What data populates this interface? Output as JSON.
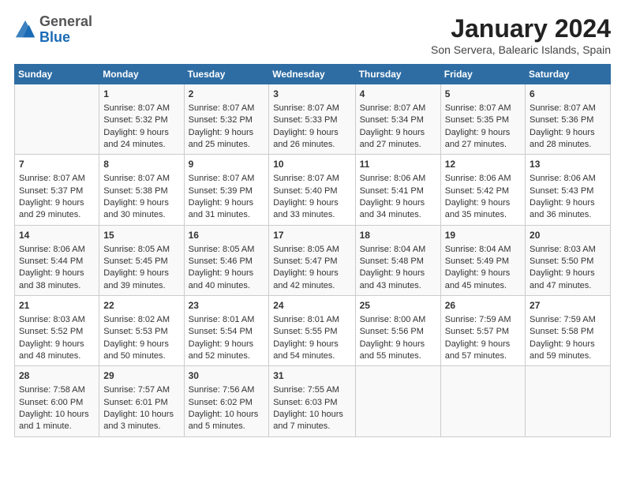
{
  "header": {
    "logo_general": "General",
    "logo_blue": "Blue",
    "month": "January 2024",
    "location": "Son Servera, Balearic Islands, Spain"
  },
  "days_of_week": [
    "Sunday",
    "Monday",
    "Tuesday",
    "Wednesday",
    "Thursday",
    "Friday",
    "Saturday"
  ],
  "weeks": [
    [
      {
        "day": "",
        "content": ""
      },
      {
        "day": "1",
        "content": "Sunrise: 8:07 AM\nSunset: 5:32 PM\nDaylight: 9 hours\nand 24 minutes."
      },
      {
        "day": "2",
        "content": "Sunrise: 8:07 AM\nSunset: 5:32 PM\nDaylight: 9 hours\nand 25 minutes."
      },
      {
        "day": "3",
        "content": "Sunrise: 8:07 AM\nSunset: 5:33 PM\nDaylight: 9 hours\nand 26 minutes."
      },
      {
        "day": "4",
        "content": "Sunrise: 8:07 AM\nSunset: 5:34 PM\nDaylight: 9 hours\nand 27 minutes."
      },
      {
        "day": "5",
        "content": "Sunrise: 8:07 AM\nSunset: 5:35 PM\nDaylight: 9 hours\nand 27 minutes."
      },
      {
        "day": "6",
        "content": "Sunrise: 8:07 AM\nSunset: 5:36 PM\nDaylight: 9 hours\nand 28 minutes."
      }
    ],
    [
      {
        "day": "7",
        "content": "Sunrise: 8:07 AM\nSunset: 5:37 PM\nDaylight: 9 hours\nand 29 minutes."
      },
      {
        "day": "8",
        "content": "Sunrise: 8:07 AM\nSunset: 5:38 PM\nDaylight: 9 hours\nand 30 minutes."
      },
      {
        "day": "9",
        "content": "Sunrise: 8:07 AM\nSunset: 5:39 PM\nDaylight: 9 hours\nand 31 minutes."
      },
      {
        "day": "10",
        "content": "Sunrise: 8:07 AM\nSunset: 5:40 PM\nDaylight: 9 hours\nand 33 minutes."
      },
      {
        "day": "11",
        "content": "Sunrise: 8:06 AM\nSunset: 5:41 PM\nDaylight: 9 hours\nand 34 minutes."
      },
      {
        "day": "12",
        "content": "Sunrise: 8:06 AM\nSunset: 5:42 PM\nDaylight: 9 hours\nand 35 minutes."
      },
      {
        "day": "13",
        "content": "Sunrise: 8:06 AM\nSunset: 5:43 PM\nDaylight: 9 hours\nand 36 minutes."
      }
    ],
    [
      {
        "day": "14",
        "content": "Sunrise: 8:06 AM\nSunset: 5:44 PM\nDaylight: 9 hours\nand 38 minutes."
      },
      {
        "day": "15",
        "content": "Sunrise: 8:05 AM\nSunset: 5:45 PM\nDaylight: 9 hours\nand 39 minutes."
      },
      {
        "day": "16",
        "content": "Sunrise: 8:05 AM\nSunset: 5:46 PM\nDaylight: 9 hours\nand 40 minutes."
      },
      {
        "day": "17",
        "content": "Sunrise: 8:05 AM\nSunset: 5:47 PM\nDaylight: 9 hours\nand 42 minutes."
      },
      {
        "day": "18",
        "content": "Sunrise: 8:04 AM\nSunset: 5:48 PM\nDaylight: 9 hours\nand 43 minutes."
      },
      {
        "day": "19",
        "content": "Sunrise: 8:04 AM\nSunset: 5:49 PM\nDaylight: 9 hours\nand 45 minutes."
      },
      {
        "day": "20",
        "content": "Sunrise: 8:03 AM\nSunset: 5:50 PM\nDaylight: 9 hours\nand 47 minutes."
      }
    ],
    [
      {
        "day": "21",
        "content": "Sunrise: 8:03 AM\nSunset: 5:52 PM\nDaylight: 9 hours\nand 48 minutes."
      },
      {
        "day": "22",
        "content": "Sunrise: 8:02 AM\nSunset: 5:53 PM\nDaylight: 9 hours\nand 50 minutes."
      },
      {
        "day": "23",
        "content": "Sunrise: 8:01 AM\nSunset: 5:54 PM\nDaylight: 9 hours\nand 52 minutes."
      },
      {
        "day": "24",
        "content": "Sunrise: 8:01 AM\nSunset: 5:55 PM\nDaylight: 9 hours\nand 54 minutes."
      },
      {
        "day": "25",
        "content": "Sunrise: 8:00 AM\nSunset: 5:56 PM\nDaylight: 9 hours\nand 55 minutes."
      },
      {
        "day": "26",
        "content": "Sunrise: 7:59 AM\nSunset: 5:57 PM\nDaylight: 9 hours\nand 57 minutes."
      },
      {
        "day": "27",
        "content": "Sunrise: 7:59 AM\nSunset: 5:58 PM\nDaylight: 9 hours\nand 59 minutes."
      }
    ],
    [
      {
        "day": "28",
        "content": "Sunrise: 7:58 AM\nSunset: 6:00 PM\nDaylight: 10 hours\nand 1 minute."
      },
      {
        "day": "29",
        "content": "Sunrise: 7:57 AM\nSunset: 6:01 PM\nDaylight: 10 hours\nand 3 minutes."
      },
      {
        "day": "30",
        "content": "Sunrise: 7:56 AM\nSunset: 6:02 PM\nDaylight: 10 hours\nand 5 minutes."
      },
      {
        "day": "31",
        "content": "Sunrise: 7:55 AM\nSunset: 6:03 PM\nDaylight: 10 hours\nand 7 minutes."
      },
      {
        "day": "",
        "content": ""
      },
      {
        "day": "",
        "content": ""
      },
      {
        "day": "",
        "content": ""
      }
    ]
  ]
}
